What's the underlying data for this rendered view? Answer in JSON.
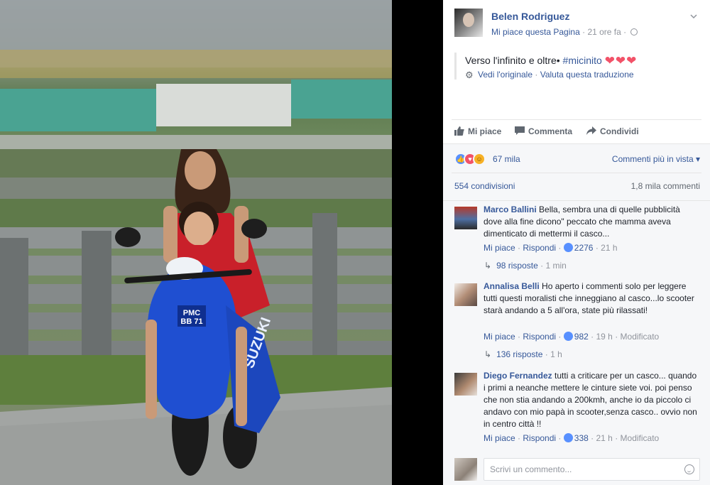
{
  "post": {
    "page_name": "Belen Rodriguez",
    "like_page": "Mi piace questa Pagina",
    "time": "21 ore fa",
    "text": "Verso l'infinito e oltre•",
    "hashtag": "#micinito",
    "hearts": "❤❤❤",
    "see_original": "Vedi l'originale",
    "rate_translation": "Valuta questa traduzione"
  },
  "actions": {
    "like": "Mi piace",
    "comment": "Commenta",
    "share": "Condividi"
  },
  "stats": {
    "reactions_count": "67 mila",
    "sort_label": "Commenti più in vista",
    "shares": "554 condivisioni",
    "comments": "1,8 mila commenti"
  },
  "comments": [
    {
      "author": "Marco Ballini",
      "text": "Bella, sembra una di quelle pubblicità dove alla fine dicono\" peccato che mamma aveva dimenticato di mettermi il casco...",
      "like": "Mi piace",
      "reply": "Rispondi",
      "likes": "2276",
      "time": "21 h",
      "edited": "",
      "replies_label": "98 risposte",
      "replies_time": "1 min"
    },
    {
      "author": "Annalisa Belli",
      "text": "Ho aperto i commenti solo per leggere tutti questi moralisti che inneggiano al casco...lo scooter starà andando a 5 all'ora, state più rilassati!",
      "like": "Mi piace",
      "reply": "Rispondi",
      "likes": "982",
      "time": "19 h",
      "edited": "Modificato",
      "replies_label": "136 risposte",
      "replies_time": "1 h"
    },
    {
      "author": "Diego Fernandez",
      "text": "tutti a criticare per un casco... quando i primi a neanche mettere le cinture siete voi. poi penso che non stia andando a 200kmh, anche io da piccolo ci andavo con mio papà in scooter,senza casco.. ovvio non in centro città !!",
      "like": "Mi piace",
      "reply": "Rispondi",
      "likes": "338",
      "time": "21 h",
      "edited": "Modificato"
    }
  ],
  "write_comment": {
    "placeholder": "Scrivi un commento..."
  },
  "photo": {
    "plate_line1": "PMC",
    "plate_line2": "BB 71",
    "brand": "SUZUKI"
  },
  "colors": {
    "link": "#365899",
    "like_blue": "#5890ff",
    "love_red": "#f25268",
    "scooter_blue": "#1f4fd1"
  }
}
